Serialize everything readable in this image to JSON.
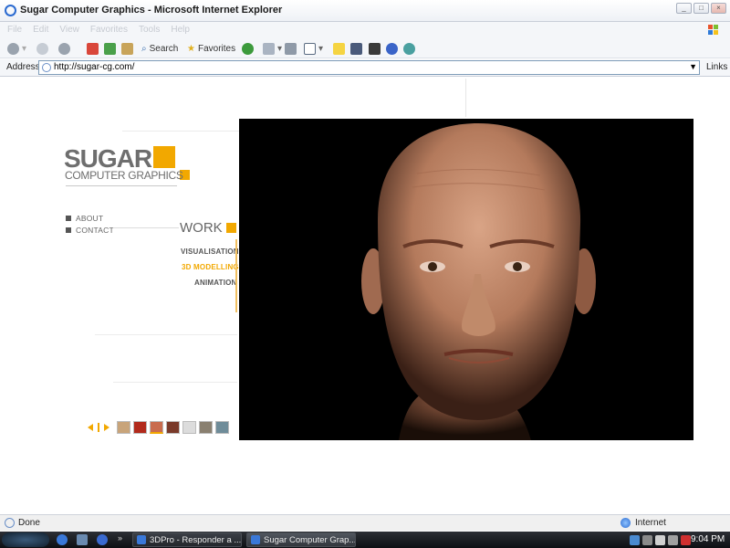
{
  "window": {
    "title": "Sugar Computer Graphics - Microsoft Internet Explorer",
    "buttons": {
      "minimize": "_",
      "maximize": "□",
      "close": "×"
    }
  },
  "menubar": {
    "items": [
      "File",
      "Edit",
      "View",
      "Favorites",
      "Tools",
      "Help"
    ]
  },
  "toolbar": {
    "search_label": "Search",
    "favorites_label": "Favorites",
    "more_chevron": "»"
  },
  "address": {
    "label": "Address",
    "url": "http://sugar-cg.com/",
    "links_label": "Links"
  },
  "site": {
    "logo_main": "SUGAR",
    "logo_sub": "COMPUTER GRAPHICS",
    "nav": [
      "ABOUT",
      "CONTACT"
    ],
    "work_label": "WORK",
    "work_items": [
      {
        "label": "VISUALISATION",
        "active": false
      },
      {
        "label": "3D MODELLING",
        "active": true
      },
      {
        "label": "ANIMATION",
        "active": false
      }
    ],
    "accent_color": "#f2a800",
    "thumbnails": [
      {
        "name": "thumb-1",
        "color": "#c8a47a"
      },
      {
        "name": "thumb-2",
        "color": "#b22a1c"
      },
      {
        "name": "thumb-3",
        "color": "#c96c4e"
      },
      {
        "name": "thumb-4",
        "color": "#7a3a2a"
      },
      {
        "name": "thumb-5",
        "color": "#dcdcdc"
      },
      {
        "name": "thumb-6",
        "color": "#8a8070"
      },
      {
        "name": "thumb-7",
        "color": "#6f8c99"
      }
    ],
    "selected_thumbnail": 3,
    "viewer_image": "3D render of an elderly bald man's head on black background"
  },
  "status": {
    "text": "Done",
    "zone": "Internet"
  },
  "taskbar": {
    "chevron": "»",
    "tasks": [
      {
        "label": "3DPro - Responder a ...",
        "active": false
      },
      {
        "label": "Sugar Computer Grap...",
        "active": true
      }
    ],
    "clock": "9:04 PM"
  }
}
